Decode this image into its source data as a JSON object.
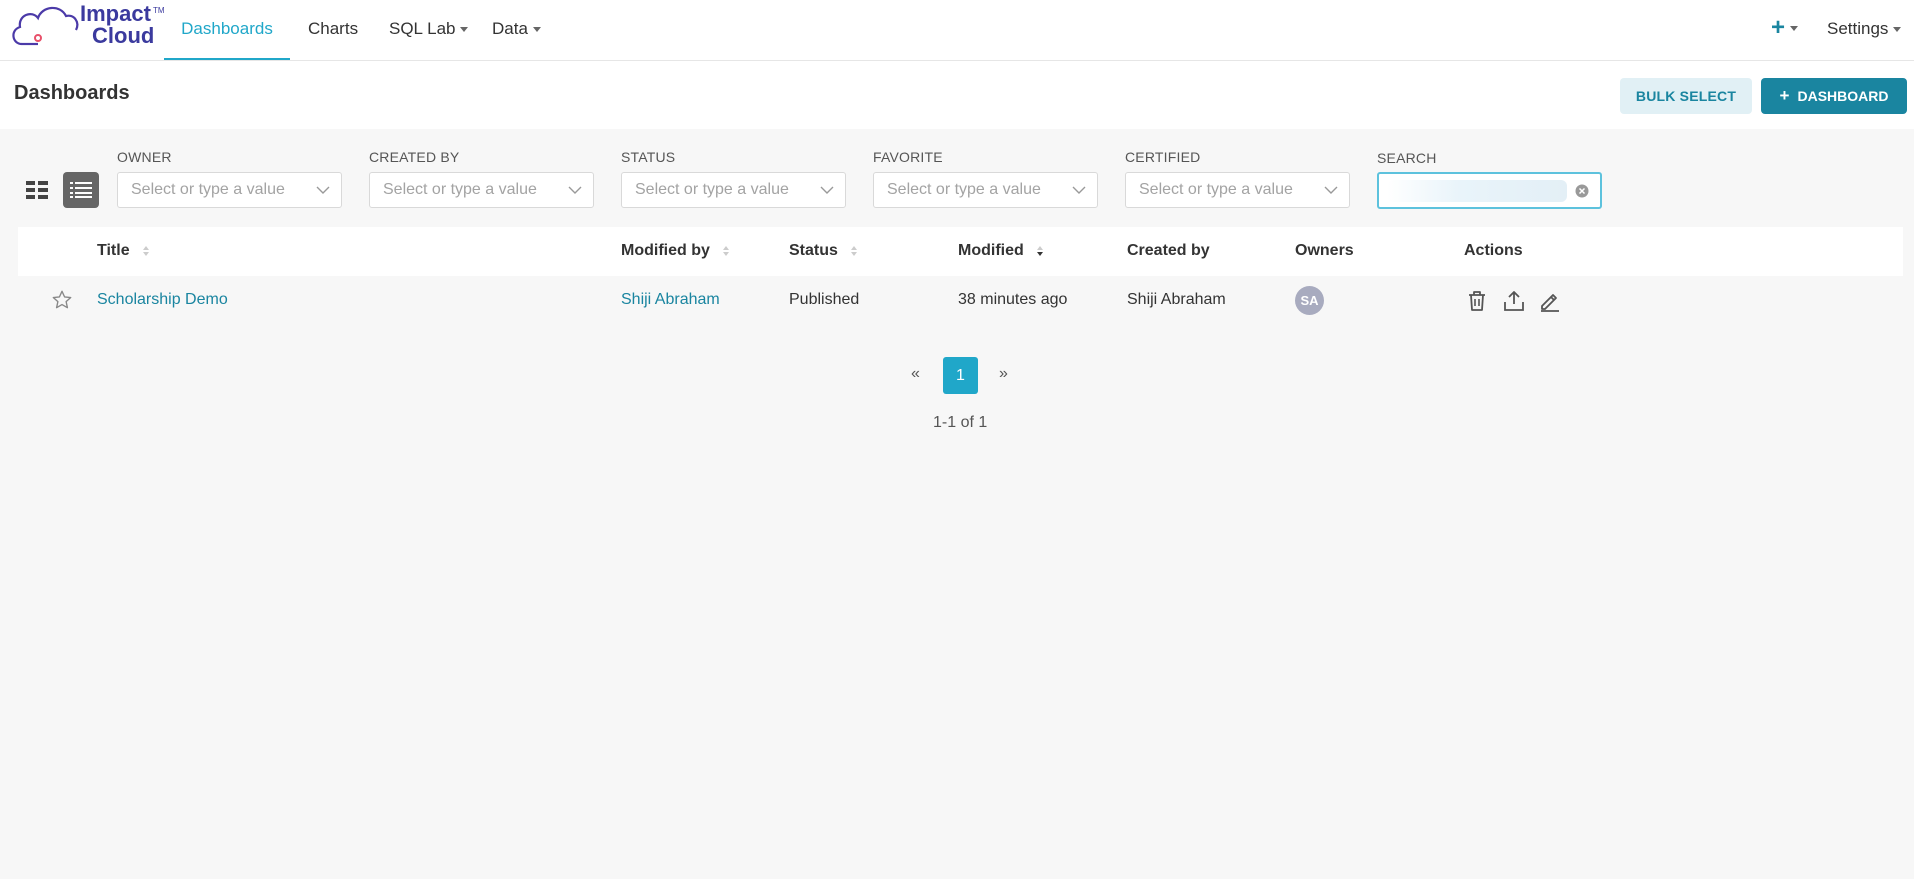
{
  "brand": {
    "line1": "Impact",
    "line2": "Cloud",
    "tm": "TM",
    "color": "#3b3a9e"
  },
  "nav": {
    "items": [
      {
        "label": "Dashboards",
        "active": true
      },
      {
        "label": "Charts"
      },
      {
        "label": "SQL Lab",
        "dropdown": true
      },
      {
        "label": "Data",
        "dropdown": true
      }
    ],
    "plus": "+",
    "settings": "Settings"
  },
  "header": {
    "title": "Dashboards",
    "bulk_select": "BULK SELECT",
    "new_dashboard": "DASHBOARD",
    "new_dashboard_icon": "+"
  },
  "filters": [
    {
      "label": "OWNER",
      "placeholder": "Select or type a value"
    },
    {
      "label": "CREATED BY",
      "placeholder": "Select or type a value"
    },
    {
      "label": "STATUS",
      "placeholder": "Select or type a value"
    },
    {
      "label": "FAVORITE",
      "placeholder": "Select or type a value"
    },
    {
      "label": "CERTIFIED",
      "placeholder": "Select or type a value"
    }
  ],
  "search": {
    "label": "SEARCH",
    "value": ""
  },
  "table": {
    "columns": [
      "Title",
      "Modified by",
      "Status",
      "Modified",
      "Created by",
      "Owners",
      "Actions"
    ],
    "rows": [
      {
        "title": "Scholarship Demo",
        "modified_by": "Shiji Abraham",
        "status": "Published",
        "modified": "38 minutes ago",
        "created_by": "Shiji Abraham",
        "owner_initials": "SA"
      }
    ]
  },
  "pagination": {
    "prev": "«",
    "page": "1",
    "next": "»",
    "count": "1-1 of 1"
  },
  "colors": {
    "accent": "#20a7c9",
    "primary": "#1a85a0",
    "bulk_bg": "#e1f0f5"
  }
}
